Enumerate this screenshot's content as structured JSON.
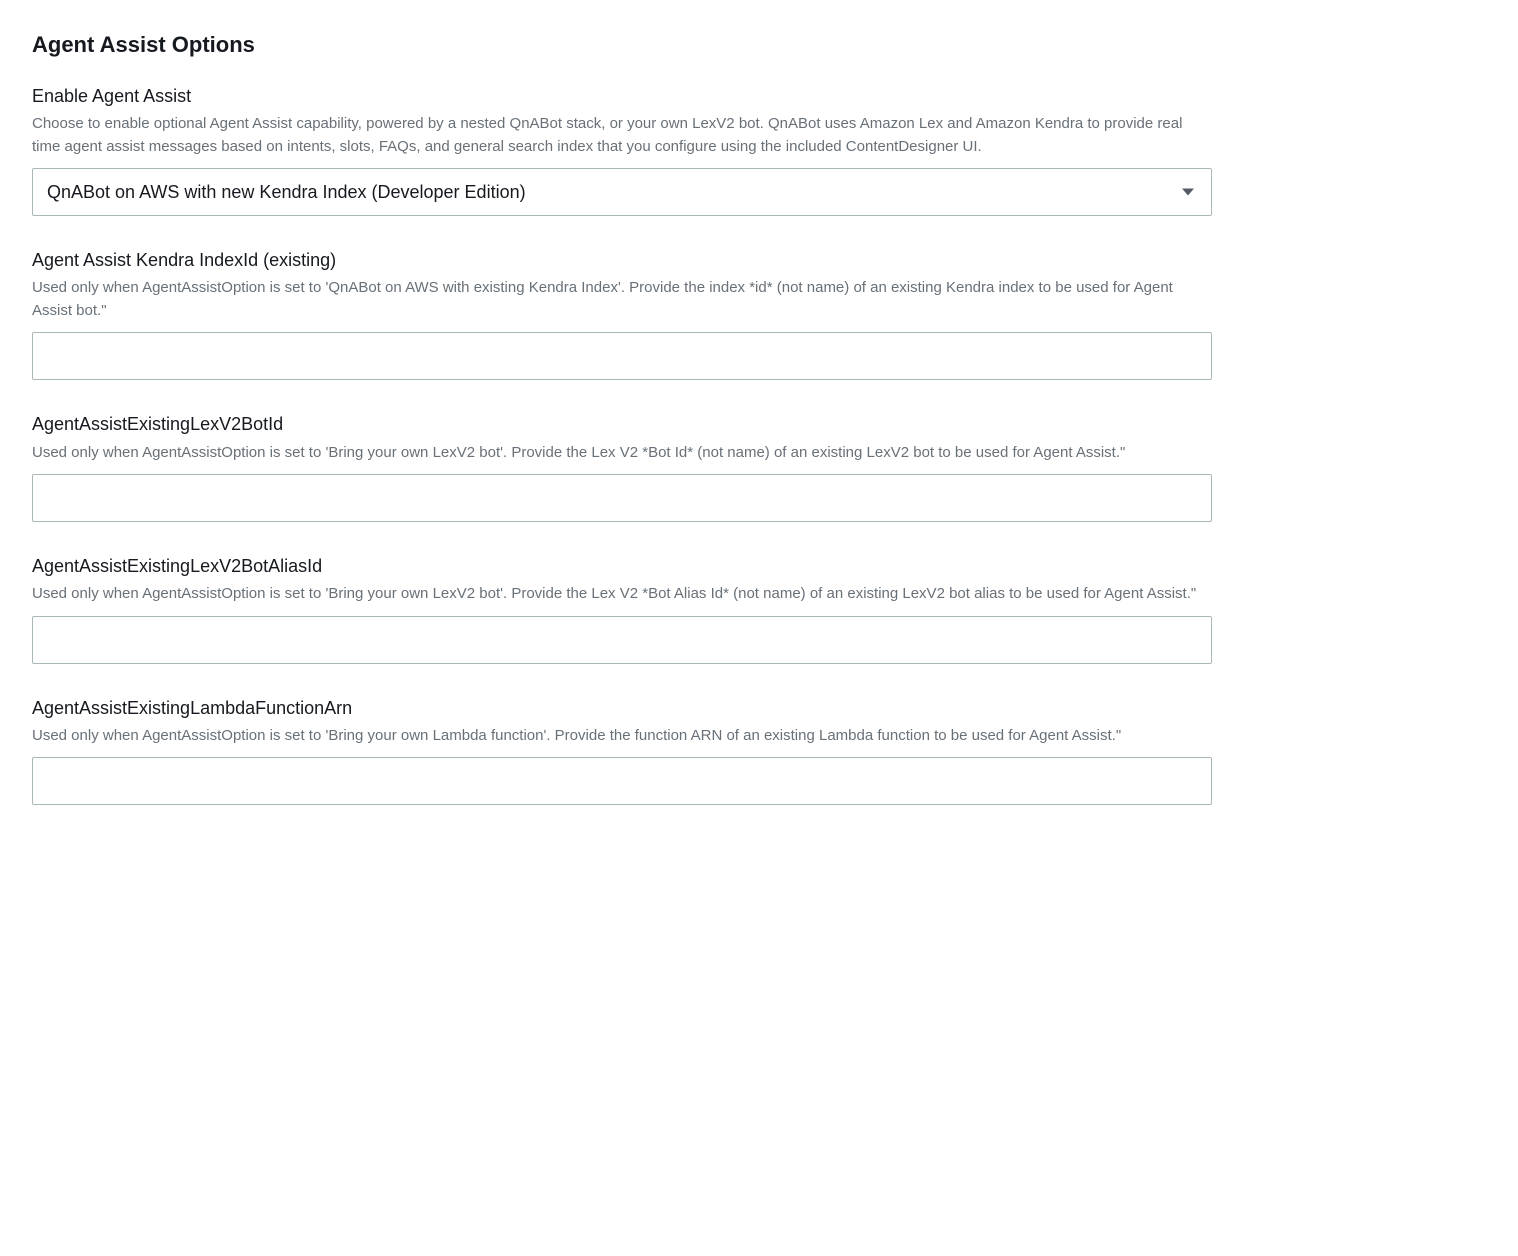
{
  "section": {
    "title": "Agent Assist Options"
  },
  "fields": {
    "enableAgentAssist": {
      "label": "Enable Agent Assist",
      "description": "Choose to enable optional Agent Assist capability, powered by a nested QnABot stack, or your own LexV2 bot. QnABot uses Amazon Lex and Amazon Kendra to provide real time agent assist messages based on intents, slots, FAQs, and general search index that you configure using the included ContentDesigner UI.",
      "value": "QnABot on AWS with new Kendra Index (Developer Edition)"
    },
    "kendraIndexId": {
      "label": "Agent Assist Kendra IndexId (existing)",
      "description": "Used only when AgentAssistOption is set to 'QnABot on AWS with existing Kendra Index'. Provide the index *id* (not name) of an existing Kendra index to be used for Agent Assist bot.\"",
      "value": ""
    },
    "lexV2BotId": {
      "label": "AgentAssistExistingLexV2BotId",
      "description": "Used only when AgentAssistOption is set to 'Bring your own LexV2 bot'. Provide the Lex V2 *Bot Id* (not name) of an existing LexV2 bot to be used for Agent Assist.\"",
      "value": ""
    },
    "lexV2BotAliasId": {
      "label": "AgentAssistExistingLexV2BotAliasId",
      "description": "Used only when AgentAssistOption is set to 'Bring your own LexV2 bot'. Provide the Lex V2 *Bot Alias Id* (not name) of an existing LexV2 bot alias to be used for Agent Assist.\"",
      "value": ""
    },
    "lambdaFunctionArn": {
      "label": "AgentAssistExistingLambdaFunctionArn",
      "description": "Used only when AgentAssistOption is set to 'Bring your own Lambda function'. Provide the function ARN of an existing Lambda function to be used for Agent Assist.\"",
      "value": ""
    }
  }
}
